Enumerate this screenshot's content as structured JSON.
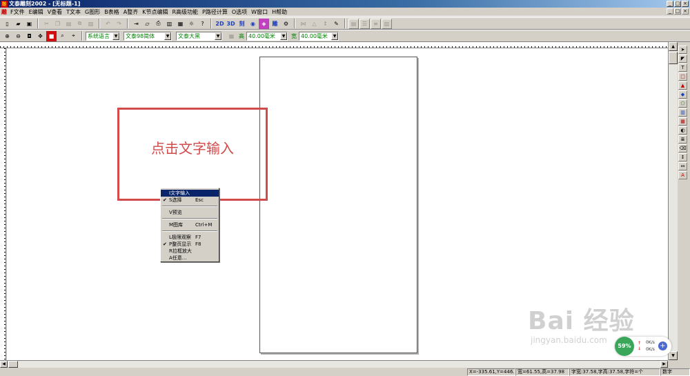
{
  "window": {
    "title": "文泰雕刻2002 - [无标题-1]",
    "icon_label": "雕",
    "controls": [
      "_",
      "□",
      "×"
    ]
  },
  "menubar": {
    "logo": "雕",
    "items": [
      "F文件",
      "E编辑",
      "V查看",
      "T文本",
      "G图形",
      "B表格",
      "A整齐",
      "K节点编辑",
      "R高级功能",
      "P路径计算",
      "O选项",
      "W窗口",
      "H帮助"
    ],
    "doc_controls": [
      "_",
      "□",
      "×"
    ]
  },
  "toolbar2": {
    "language_combo": "系统语言",
    "font_combo": "文泰98简体",
    "size_combo": "文泰大黑",
    "height_label": "高",
    "height_value": "40.00毫米",
    "width_label": "宽",
    "width_value": "40.00毫米"
  },
  "canvas": {
    "callout_text": "点击文字输入"
  },
  "context_menu": {
    "items": [
      {
        "label": "I文字输入",
        "shortcut": "",
        "checked": false,
        "highlighted": true
      },
      {
        "label": "S选择",
        "shortcut": "Esc",
        "checked": true,
        "highlighted": false
      },
      {
        "label": "V预览",
        "shortcut": "",
        "checked": false,
        "highlighted": false
      },
      {
        "label": "M图库",
        "shortcut": "Ctrl+M",
        "checked": false,
        "highlighted": false
      },
      {
        "label": "L极限观察",
        "shortcut": "F7",
        "checked": false,
        "highlighted": false
      },
      {
        "label": "P整页显示",
        "shortcut": "F8",
        "checked": true,
        "highlighted": false
      },
      {
        "label": "R拉框放大",
        "shortcut": "",
        "checked": false,
        "highlighted": false
      },
      {
        "label": "A任意...",
        "shortcut": "",
        "checked": false,
        "highlighted": false
      }
    ]
  },
  "statusbar": {
    "coords": "X=-335.61,Y=446.06",
    "size": "宽=61.55,高=37.98",
    "char_size": "字宽:37.58,字高:37.58,字符=个",
    "mode": "数字"
  },
  "watermark": {
    "main": "Bai 经验",
    "sub": "jingyan.baidu.com"
  },
  "speed_widget": {
    "percent": "59%",
    "up": "0K/s",
    "down": "0K/s"
  }
}
